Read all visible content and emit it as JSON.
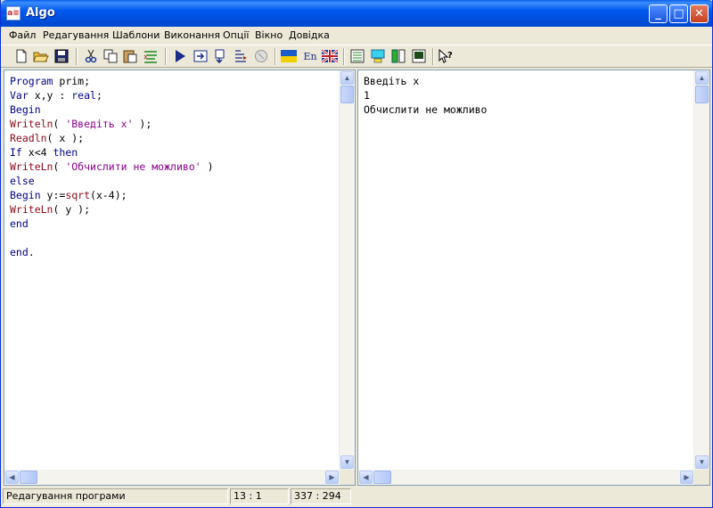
{
  "window": {
    "title": "Algo",
    "app_icon_text": "a≡"
  },
  "menu": [
    "Файл",
    "Редагування",
    "Шаблони",
    "Виконання",
    "Опції",
    "Вікно",
    "Довідка"
  ],
  "toolbar": {
    "lang_label": "En"
  },
  "editor": {
    "lines": [
      [
        [
          "kw",
          "Program"
        ],
        [
          "plain",
          " prim;"
        ]
      ],
      [
        [
          "kw",
          "Var"
        ],
        [
          "plain",
          " x,y : "
        ],
        [
          "kw",
          "real"
        ],
        [
          "plain",
          ";"
        ]
      ],
      [
        [
          "kw",
          "Begin"
        ]
      ],
      [
        [
          "fn",
          "Writeln"
        ],
        [
          "plain",
          "( "
        ],
        [
          "str",
          "'Введіть х'"
        ],
        [
          "plain",
          " );"
        ]
      ],
      [
        [
          "fn",
          "Readln"
        ],
        [
          "plain",
          "( x );"
        ]
      ],
      [
        [
          "kw",
          "If"
        ],
        [
          "plain",
          " x<4 "
        ],
        [
          "kw",
          "then"
        ]
      ],
      [
        [
          "fn",
          "WriteLn"
        ],
        [
          "plain",
          "( "
        ],
        [
          "str",
          "'Обчислити не можливо'"
        ],
        [
          "plain",
          " )"
        ]
      ],
      [
        [
          "kw",
          "else"
        ]
      ],
      [
        [
          "kw",
          "Begin"
        ],
        [
          "plain",
          " y:="
        ],
        [
          "fn",
          "sqrt"
        ],
        [
          "plain",
          "(x-4);"
        ]
      ],
      [
        [
          "fn",
          "WriteLn"
        ],
        [
          "plain",
          "( y );"
        ]
      ],
      [
        [
          "kw",
          "end"
        ]
      ],
      [
        [
          "plain",
          ""
        ]
      ],
      [
        [
          "kw",
          "end."
        ]
      ]
    ]
  },
  "output": {
    "lines": [
      "Введіть х",
      "1",
      "Обчислити не можливо"
    ]
  },
  "status": {
    "mode": "Редагування програми",
    "cursor": "13 :  1",
    "size": "337 : 294"
  }
}
